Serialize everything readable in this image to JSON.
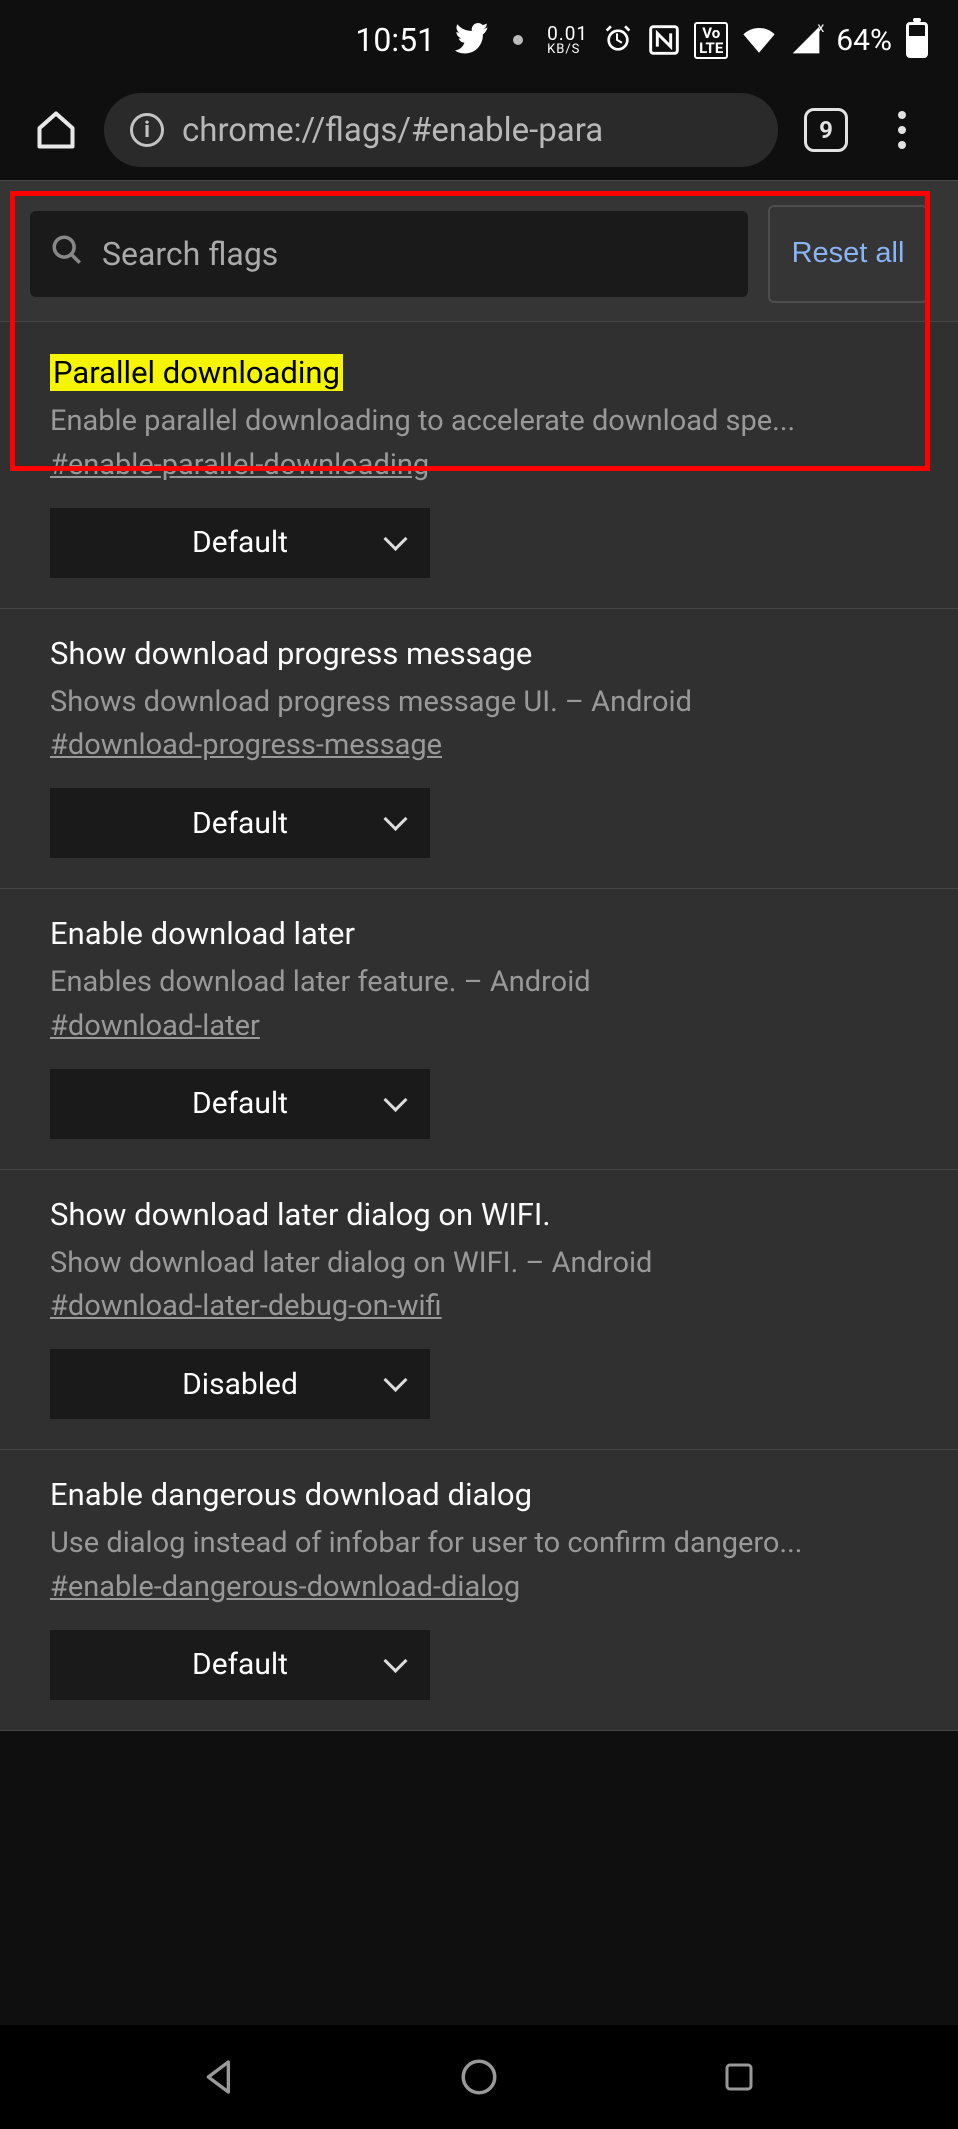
{
  "status": {
    "time": "10:51",
    "kbs_value": "0.01",
    "kbs_label": "KB/S",
    "volte": "Vo\nLTE",
    "battery_pct": "64%"
  },
  "browser": {
    "url": "chrome://flags/#enable-para",
    "tab_count": "9"
  },
  "page": {
    "search_placeholder": "Search flags",
    "reset_label": "Reset all"
  },
  "flags": [
    {
      "title": "Parallel downloading",
      "highlighted": true,
      "desc": "Enable parallel downloading to accelerate download spe...",
      "hash": "#enable-parallel-downloading",
      "value": "Default"
    },
    {
      "title": "Show download progress message",
      "highlighted": false,
      "desc": "Shows download progress message UI. – Android",
      "hash": "#download-progress-message",
      "value": "Default"
    },
    {
      "title": "Enable download later",
      "highlighted": false,
      "desc": "Enables download later feature. – Android",
      "hash": "#download-later",
      "value": "Default"
    },
    {
      "title": "Show download later dialog on WIFI.",
      "highlighted": false,
      "desc": "Show download later dialog on WIFI. – Android",
      "hash": "#download-later-debug-on-wifi",
      "value": "Disabled"
    },
    {
      "title": "Enable dangerous download dialog",
      "highlighted": false,
      "desc": "Use dialog instead of infobar for user to confirm dangero...",
      "hash": "#enable-dangerous-download-dialog",
      "value": "Default"
    }
  ]
}
